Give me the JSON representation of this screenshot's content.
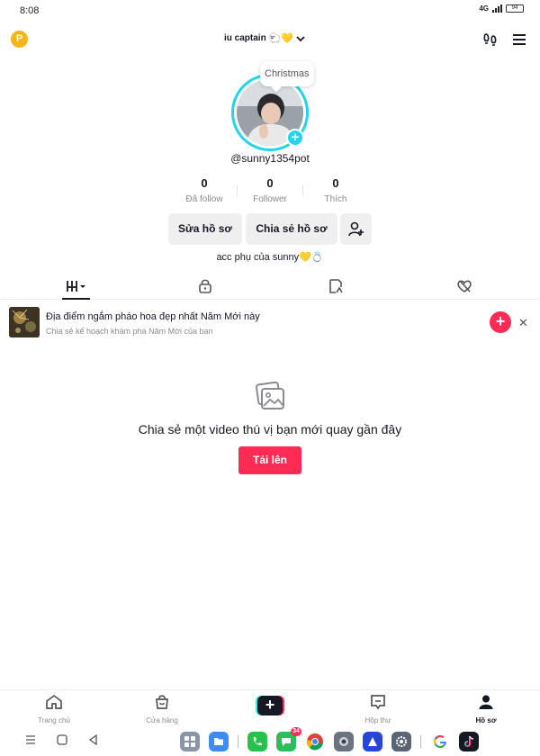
{
  "status_bar": {
    "time": "8:08",
    "network": "4G",
    "battery": "94"
  },
  "header": {
    "coin_label": "P",
    "account_name": "iu captain",
    "account_emoji": "🐑💛"
  },
  "profile": {
    "bubble_text": "Christmas",
    "username": "@sunny1354pot",
    "stats": [
      {
        "value": "0",
        "label": "Đã follow"
      },
      {
        "value": "0",
        "label": "Follower"
      },
      {
        "value": "0",
        "label": "Thích"
      }
    ],
    "edit_button": "Sửa hồ sơ",
    "share_button": "Chia sẻ hồ sơ",
    "bio": "acc phụ của sunny💛💍"
  },
  "tabs": [
    "videos-grid",
    "private",
    "reposts",
    "liked"
  ],
  "promo": {
    "title": "Địa điểm ngắm pháo hoa đẹp nhất Năm Mới này",
    "subtitle": "Chia sẻ kế hoạch khám phá Năm Mới của bạn",
    "add_label": "+",
    "close_label": "✕"
  },
  "empty_state": {
    "title": "Chia sẻ một video thú vị bạn mới quay gần đây",
    "upload_button": "Tải lên"
  },
  "bottom_nav": {
    "home": "Trang chủ",
    "shop": "Cửa hàng",
    "create": "+",
    "inbox": "Hộp thư",
    "profile": "Hồ sơ"
  },
  "system_bar": {
    "messages_badge": "34",
    "colors": {
      "accent": "#fe2c55",
      "cyan": "#20d5ec"
    }
  }
}
